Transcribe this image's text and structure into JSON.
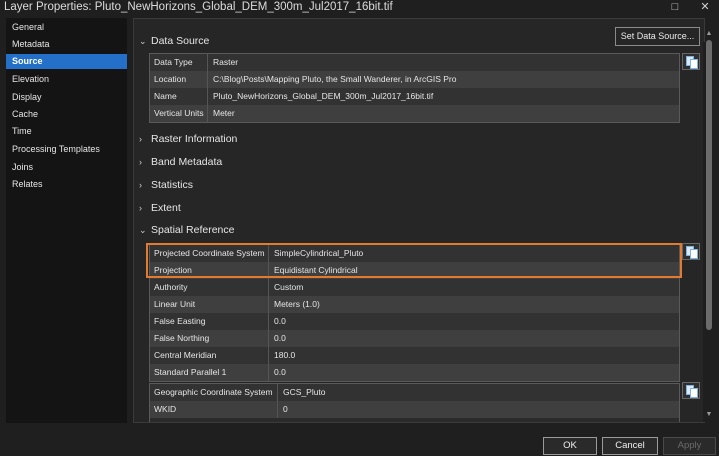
{
  "window": {
    "title": "Layer Properties: Pluto_NewHorizons_Global_DEM_300m_Jul2017_16bit.tif",
    "maximize_glyph": "□",
    "close_glyph": "✕"
  },
  "sidebar": {
    "items": [
      {
        "label": "General"
      },
      {
        "label": "Metadata"
      },
      {
        "label": "Source",
        "active": true
      },
      {
        "label": "Elevation"
      },
      {
        "label": "Display"
      },
      {
        "label": "Cache"
      },
      {
        "label": "Time"
      },
      {
        "label": "Processing Templates"
      },
      {
        "label": "Joins"
      },
      {
        "label": "Relates"
      }
    ]
  },
  "toolbar": {
    "set_data_source_label": "Set Data Source..."
  },
  "data_source": {
    "heading": "Data Source",
    "rows": [
      {
        "key": "Data Type",
        "value": "Raster"
      },
      {
        "key": "Location",
        "value": "C:\\Blog\\Posts\\Mapping Pluto, the Small Wanderer, in ArcGIS Pro"
      },
      {
        "key": "Name",
        "value": "Pluto_NewHorizons_Global_DEM_300m_Jul2017_16bit.tif"
      },
      {
        "key": "Vertical Units",
        "value": "Meter"
      }
    ]
  },
  "collapsed_sections": [
    "Raster Information",
    "Band Metadata",
    "Statistics",
    "Extent"
  ],
  "spatial_reference": {
    "heading": "Spatial Reference",
    "projected_rows": [
      {
        "key": "Projected Coordinate System",
        "value": "SimpleCylindrical_Pluto"
      },
      {
        "key": "Projection",
        "value": "Equidistant Cylindrical"
      },
      {
        "key": "Authority",
        "value": "Custom"
      },
      {
        "key": "Linear Unit",
        "value": "Meters (1.0)"
      },
      {
        "key": "False Easting",
        "value": "0.0"
      },
      {
        "key": "False Northing",
        "value": "0.0"
      },
      {
        "key": "Central Meridian",
        "value": "180.0"
      },
      {
        "key": "Standard Parallel 1",
        "value": "0.0"
      }
    ],
    "geographic_rows": [
      {
        "key": "Geographic Coordinate System",
        "value": "GCS_Pluto"
      },
      {
        "key": "WKID",
        "value": "0"
      }
    ]
  },
  "chevrons": {
    "expanded": "⌄",
    "collapsed": "›"
  },
  "scroll": {
    "up_glyph": "▲",
    "down_glyph": "▼"
  },
  "footer": {
    "ok_label": "OK",
    "cancel_label": "Cancel",
    "apply_label": "Apply"
  },
  "colors": {
    "accent": "#2470c8",
    "highlight": "#e27b2f"
  },
  "icons": {
    "copy": "copy-icon"
  }
}
